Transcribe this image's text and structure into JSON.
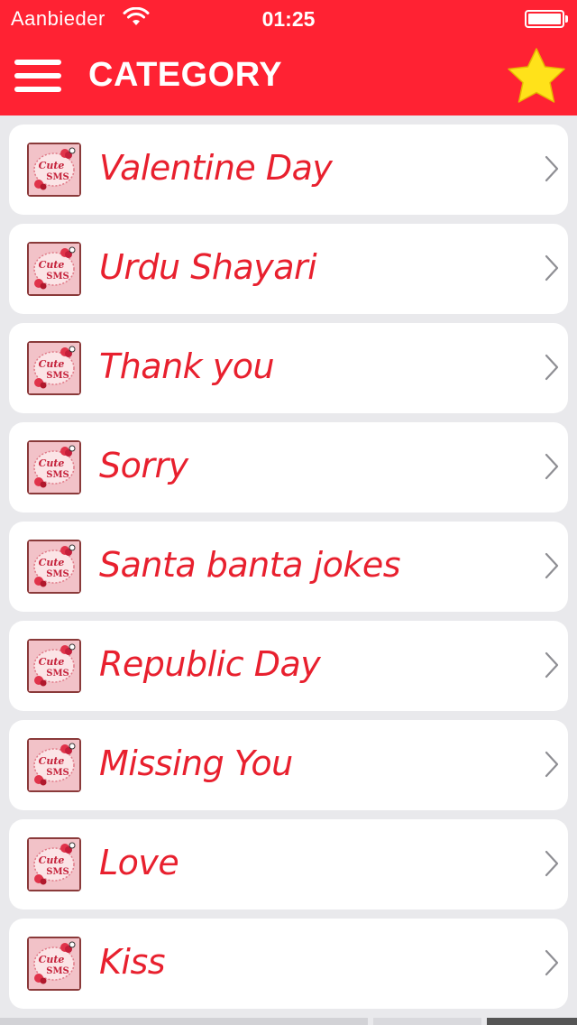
{
  "status_bar": {
    "carrier": "Aanbieder",
    "time": "01:25"
  },
  "header": {
    "title": "CATEGORY"
  },
  "icons": {
    "menu": "hamburger-menu-icon",
    "favorite": "star-icon",
    "row_thumbnail": "cute-sms-icon",
    "row_chevron": "chevron-right-icon"
  },
  "colors": {
    "header_bg": "#ff2233",
    "label_text": "#e8202e",
    "star": "#ffe21a",
    "list_bg": "#e9e9ec"
  },
  "thumbnail_text": {
    "line1": "Cute",
    "line2": "SMS"
  },
  "categories": [
    {
      "label": "Valentine Day"
    },
    {
      "label": "Urdu Shayari"
    },
    {
      "label": "Thank you"
    },
    {
      "label": "Sorry"
    },
    {
      "label": "Santa banta jokes"
    },
    {
      "label": "Republic Day"
    },
    {
      "label": "Missing You"
    },
    {
      "label": "Love"
    },
    {
      "label": "Kiss"
    }
  ]
}
